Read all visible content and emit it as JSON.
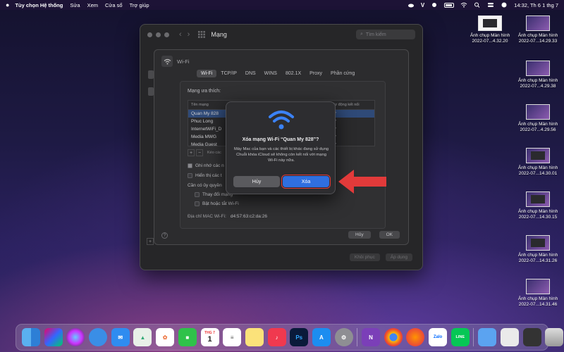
{
  "menubar": {
    "app": "Tùy chọn Hệ thống",
    "items": [
      "Sửa",
      "Xem",
      "Cửa sổ",
      "Trợ giúp"
    ],
    "clock": "14:32, Th 6 1 thg 7"
  },
  "window": {
    "title": "Mạng",
    "search_placeholder": "Tìm kiếm",
    "footer_buttons": [
      "Khôi phục",
      "Áp dụng"
    ]
  },
  "wifi_sheet": {
    "header": "Wi-Fi",
    "tabs": [
      "Wi-Fi",
      "TCP/IP",
      "DNS",
      "WINS",
      "802.1X",
      "Proxy",
      "Phần cứng"
    ],
    "active_tab": "Wi-Fi",
    "preferred_label": "Mạng ưa thích:",
    "columns": [
      "Tên mạng",
      "Tự động kết nối"
    ],
    "networks": [
      {
        "name": "Quan My 828",
        "auto": "✓"
      },
      {
        "name": "Phuc Long",
        "auto": "✓"
      },
      {
        "name": "InternetWiFi_D",
        "auto": "✓"
      },
      {
        "name": "Media MWG",
        "auto": "✓"
      },
      {
        "name": "Media Guest",
        "auto": "✓"
      }
    ],
    "add_label": "+",
    "remove_label": "−",
    "drag_hint": "Kéo các",
    "options": [
      "Ghi nhớ các n",
      "Hiển thị các t"
    ],
    "admin_label": "Cần có ủy quyền",
    "admin_options": [
      "Thay đổi mạng",
      "Bật hoặc tắt Wi-Fi"
    ],
    "mac_label": "Địa chỉ MAC Wi-Fi:",
    "mac_value": "d4:57:63:c2:da:26",
    "cancel": "Hủy",
    "ok": "OK",
    "help": "?"
  },
  "dialog": {
    "title": "Xóa mạng Wi-Fi “Quan My 828”?",
    "message": "Máy Mac của bạn và các thiết bị khác đang sử dụng Chuỗi khóa iCloud sẽ không còn kết nối với mạng Wi-Fi này nữa.",
    "cancel": "Hủy",
    "confirm": "Xóa",
    "accent": "#2f6fe0"
  },
  "desktop": {
    "left_captions": [
      [
        "Ảnh chụp Màn hình",
        "2022-07...4.32.20"
      ]
    ],
    "right_captions": [
      [
        "Ảnh chụp Màn hình",
        "2022-07...14.29.33"
      ],
      [
        "Ảnh chụp Màn hình",
        "2022-07...4.29.38"
      ],
      [
        "Ảnh chụp Màn hình",
        "2022-07...4.29.56"
      ],
      [
        "Ảnh chụp Màn hình",
        "2022-07...14.30.01"
      ],
      [
        "Ảnh chụp Màn hình",
        "2022-07...14.30.15"
      ],
      [
        "Ảnh chụp Màn hình",
        "2022-07...14.31.26"
      ],
      [
        "Ảnh chụp Màn hình",
        "2022-07...14.31.46"
      ]
    ]
  },
  "dock": {
    "calendar_month": "THG 7",
    "calendar_day": "1",
    "ps": "Ps",
    "zalo": "Zalo",
    "line": "LINE",
    "onenote": "N"
  }
}
